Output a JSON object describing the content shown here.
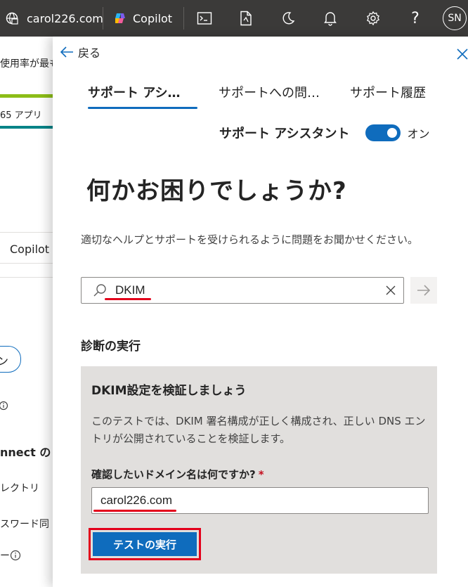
{
  "topbar": {
    "domain": "carol226.com",
    "copilot_label": "Copilot",
    "avatar_initials": "SN",
    "icons": [
      "building-icon",
      "copilot-logo-icon",
      "terminal-icon",
      "document-icon",
      "moon-icon",
      "bell-icon",
      "gear-icon",
      "help-icon"
    ]
  },
  "background_page": {
    "text_usage": "使用率が最も",
    "text_apps": "65 アプリ",
    "text_copilot": "Copilot",
    "text_connect": "nnect の",
    "text_directory": "レクトリ",
    "text_password": "スワード同",
    "text_dash": "ー"
  },
  "panel": {
    "back_label": "戻る",
    "tabs": [
      {
        "label": "サポート アシ…",
        "active": true
      },
      {
        "label": "サポートへの問…",
        "active": false
      },
      {
        "label": "サポート履歴",
        "active": false
      }
    ],
    "assistant_toggle": {
      "label": "サポート アシスタント",
      "state": "オン",
      "on": true
    },
    "heading": "何かお困りでしょうか?",
    "description": "適切なヘルプとサポートを受けられるように問題をお聞かせください。",
    "search": {
      "value": "DKIM"
    },
    "diagnostics_title": "診断の実行",
    "diagnostic": {
      "title": "DKIM設定を検証しましょう",
      "text": "このテストでは、DKIM 署名構成が正しく構成され、正しい DNS エントリが公開されていることを検証します。",
      "field_label": "確認したいドメイン名は何ですか?",
      "required_mark": "*",
      "field_value": "carol226.com",
      "run_button": "テストの実行"
    }
  },
  "colors": {
    "accent": "#0f6cbd",
    "annotation_red": "#e3001b",
    "topbar": "#3b3a39",
    "diag_box": "#e1dfdd"
  }
}
